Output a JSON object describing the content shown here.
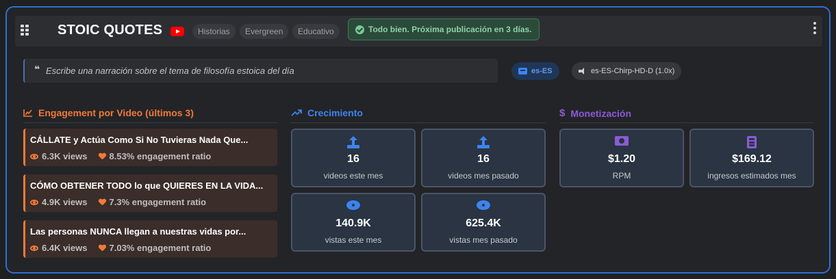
{
  "header": {
    "title": "STOIC QUOTES",
    "tags": [
      "Historias",
      "Evergreen",
      "Educativo"
    ],
    "status": "Todo bien. Próxima publicación en 3 días."
  },
  "prompt": {
    "quote_mark": "❝",
    "text": "Escribe una narración sobre el tema de filosofía estoica del día"
  },
  "language": "es-ES",
  "voice": "es-ES-Chirp-HD-D (1.0x)",
  "engagement": {
    "title": "Engagement por Video (últimos 3)",
    "items": [
      {
        "title": "CÁLLATE y Actúa Como Si No Tuvieras Nada Que...",
        "views": "6.3K views",
        "ratio": "8.53% engagement ratio"
      },
      {
        "title": "CÓMO OBTENER TODO lo que QUIERES EN LA VIDA...",
        "views": "4.9K views",
        "ratio": "7.3% engagement ratio"
      },
      {
        "title": "Las personas NUNCA llegan a nuestras vidas por...",
        "views": "6.4K views",
        "ratio": "7.03% engagement ratio"
      }
    ]
  },
  "growth": {
    "title": "Crecimiento",
    "stats": [
      {
        "icon": "upload-icon",
        "value": "16",
        "label": "videos este mes"
      },
      {
        "icon": "upload-icon",
        "value": "16",
        "label": "videos mes pasado"
      },
      {
        "icon": "eye-icon",
        "value": "140.9K",
        "label": "vistas este mes"
      },
      {
        "icon": "eye-icon",
        "value": "625.4K",
        "label": "vistas mes pasado"
      }
    ]
  },
  "monetization": {
    "title": "Monetización",
    "stats": [
      {
        "icon": "money-icon",
        "value": "$1.20",
        "label": "RPM"
      },
      {
        "icon": "calculator-icon",
        "value": "$169.12",
        "label": "ingresos estimados mes"
      }
    ]
  },
  "colors": {
    "engagement": "#f07a38",
    "growth": "#3d84f0",
    "monetization": "#8a5bd6",
    "card_border": "#2f6fd0"
  }
}
